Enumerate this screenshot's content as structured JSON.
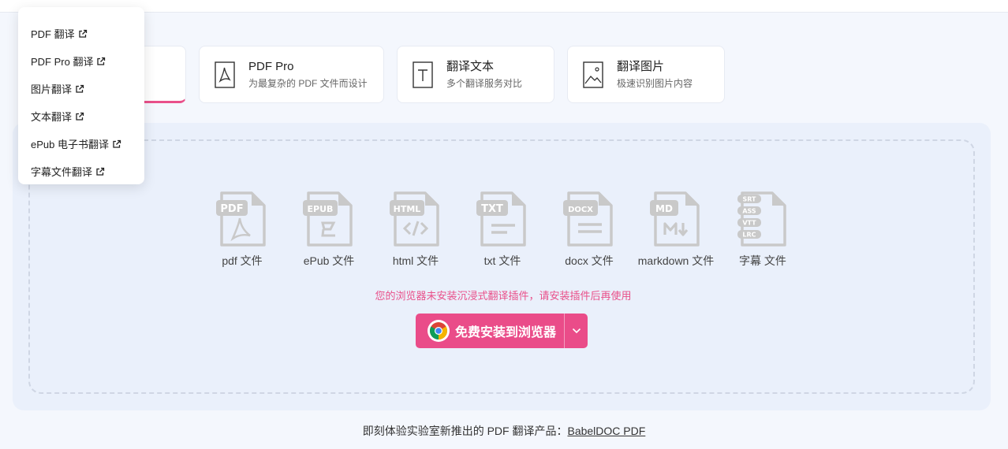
{
  "cards": [
    {
      "title": "PDF Pro",
      "subtitle": "为最复杂的 PDF 文件而设计",
      "icon": "pdf-icon"
    },
    {
      "title": "翻译文本",
      "subtitle": "多个翻译服务对比",
      "icon": "text-icon"
    },
    {
      "title": "翻译图片",
      "subtitle": "极速识别图片内容",
      "icon": "image-icon"
    }
  ],
  "file_types": [
    {
      "label": "pdf 文件",
      "badge": "PDF"
    },
    {
      "label": "ePub 文件",
      "badge": "EPUB"
    },
    {
      "label": "html 文件",
      "badge": "HTML"
    },
    {
      "label": "txt 文件",
      "badge": "TXT"
    },
    {
      "label": "docx 文件",
      "badge": "DOCX"
    },
    {
      "label": "markdown 文件",
      "badge": "MD"
    },
    {
      "label": "字幕 文件",
      "badge": [
        "SRT",
        "ASS",
        "VTT",
        "LRC"
      ]
    }
  ],
  "warning": "您的浏览器未安装沉浸式翻译插件，请安装插件后再使用",
  "install_button": "免费安装到浏览器",
  "footer": {
    "text": "即刻体验实验室新推出的 PDF 翻译产品：",
    "link": "BabelDOC PDF"
  },
  "dropdown": [
    "PDF 翻译",
    "PDF Pro 翻译",
    "图片翻译",
    "文本翻译",
    "ePub 电子书翻译",
    "字幕文件翻译"
  ],
  "colors": {
    "accent": "#ea4c89",
    "warning": "#e9508a",
    "file_icon": "#c9c9c9"
  }
}
